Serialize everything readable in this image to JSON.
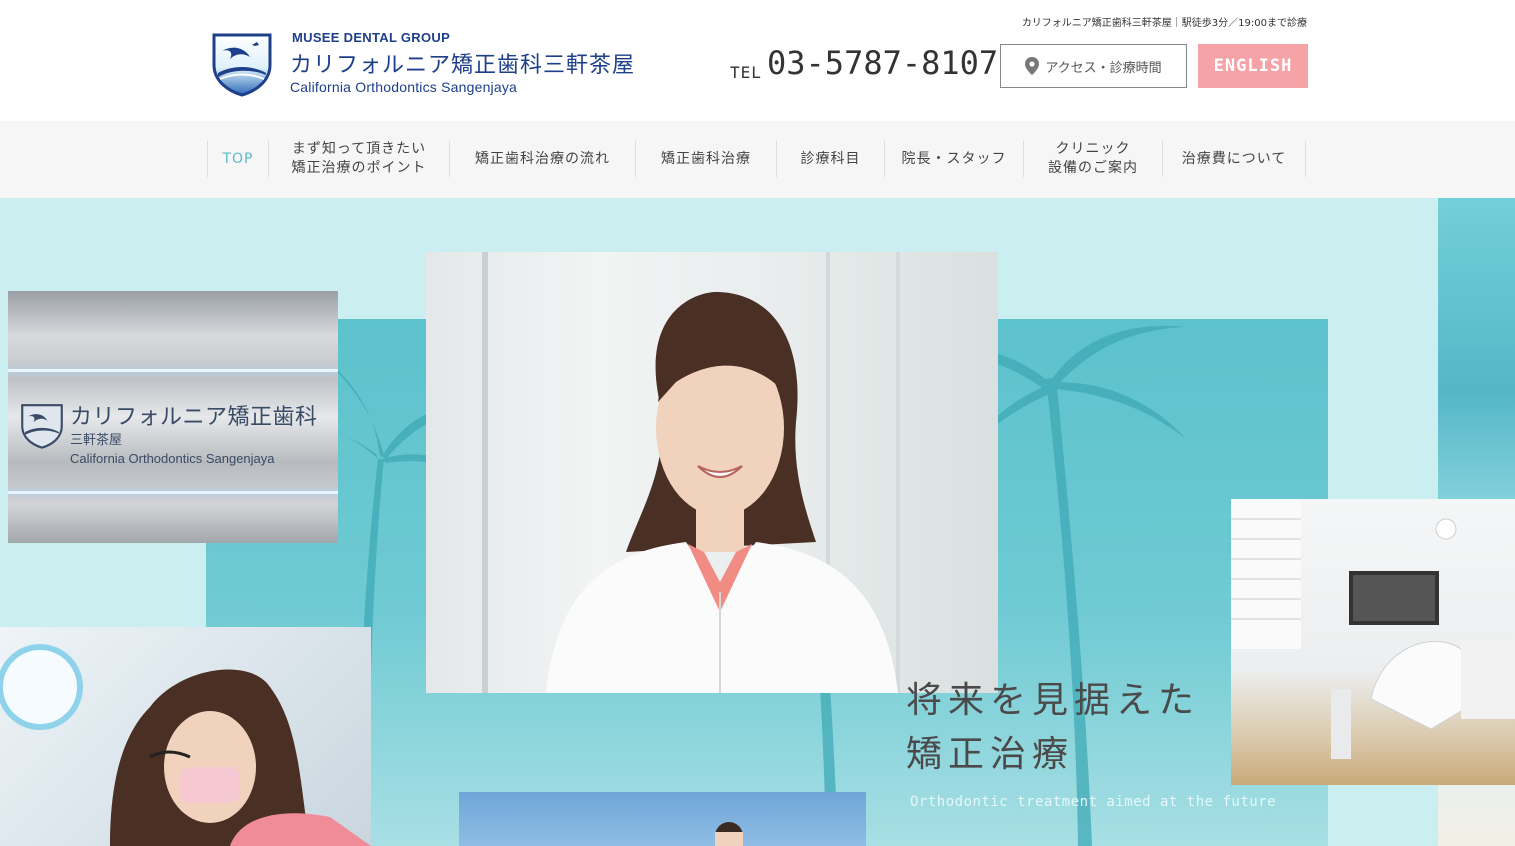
{
  "header": {
    "group": "MUSEE DENTAL GROUP",
    "clinic_ja": "カリフォルニア矯正歯科三軒茶屋",
    "clinic_en": "California Orthodontics Sangenjaya",
    "tagline": "カリフォルニア矯正歯科三軒茶屋｜駅徒歩3分／19:00まで診療",
    "tel_label": "TEL",
    "tel_number": "03-5787-8107",
    "access_label": "アクセス・診療時間",
    "english_label": "ENGLISH",
    "english_color": "#f5a3a7"
  },
  "nav": {
    "items": [
      {
        "label": "TOP",
        "active": true
      },
      {
        "label": "まず知って頂きたい\n矯正治療のポイント"
      },
      {
        "label": "矯正歯科治療の流れ"
      },
      {
        "label": "矯正歯科治療"
      },
      {
        "label": "診療科目"
      },
      {
        "label": "院長・スタッフ"
      },
      {
        "label": "クリニック\n設備のご案内"
      },
      {
        "label": "治療費について"
      }
    ]
  },
  "hero": {
    "catch_line1": "将来を見据えた",
    "catch_line2": "矯正治療",
    "catch_en": "Orthodontic treatment aimed at the future",
    "sign_ja": "カリフォルニア矯正歯科",
    "sign_sub": "三軒茶屋",
    "sign_en": "California Orthodontics Sangenjaya",
    "accent_color": "#5cc2cc"
  }
}
